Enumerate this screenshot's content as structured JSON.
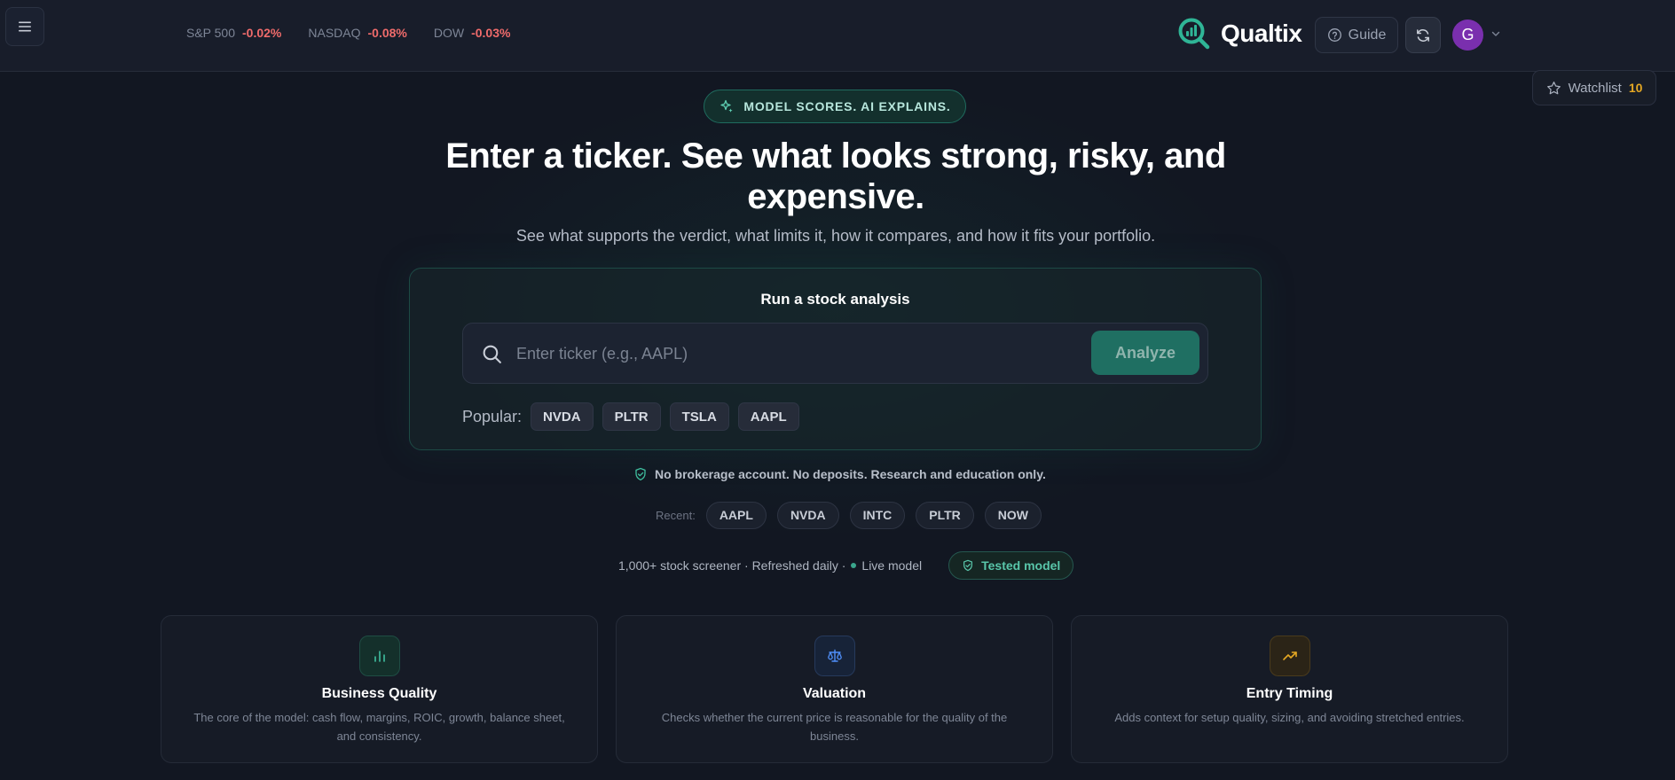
{
  "market": [
    {
      "label": "S&P 500",
      "change": "-0.02%"
    },
    {
      "label": "NASDAQ",
      "change": "-0.08%"
    },
    {
      "label": "DOW",
      "change": "-0.03%"
    }
  ],
  "brand": {
    "name": "Qualtix"
  },
  "header": {
    "guide_label": "Guide",
    "avatar_initial": "G"
  },
  "watchlist": {
    "label": "Watchlist",
    "count": "10"
  },
  "hero": {
    "badge": "MODEL SCORES. AI EXPLAINS.",
    "headline": "Enter a ticker. See what looks strong, risky, and expensive.",
    "subhead": "See what supports the verdict, what limits it, how it compares, and how it fits your portfolio."
  },
  "analysis": {
    "title": "Run a stock analysis",
    "placeholder": "Enter ticker (e.g., AAPL)",
    "value": "",
    "analyze_label": "Analyze",
    "popular_label": "Popular:",
    "popular": [
      "NVDA",
      "PLTR",
      "TSLA",
      "AAPL"
    ]
  },
  "disclaimer": "No brokerage account. No deposits. Research and education only.",
  "recent": {
    "label": "Recent:",
    "items": [
      "AAPL",
      "NVDA",
      "INTC",
      "PLTR",
      "NOW"
    ]
  },
  "meta": {
    "text": "1,000+ stock screener · Refreshed daily ·",
    "live_label": "Live model",
    "tested_label": "Tested model"
  },
  "features": [
    {
      "icon": "bar-chart-icon",
      "color": "#3fbf9f",
      "title": "Business Quality",
      "desc": "The core of the model: cash flow, margins, ROIC, growth, balance sheet, and consistency."
    },
    {
      "icon": "scale-icon",
      "color": "#4f8ef7",
      "title": "Valuation",
      "desc": "Checks whether the current price is reasonable for the quality of the business."
    },
    {
      "icon": "trending-up-icon",
      "color": "#e5a823",
      "title": "Entry Timing",
      "desc": "Adds context for setup quality, sizing, and avoiding stretched entries."
    }
  ],
  "colors": {
    "accent": "#1f6f62",
    "negative": "#ef6b6b",
    "watchlist_count": "#e5a823",
    "avatar": "#7a2fae"
  }
}
